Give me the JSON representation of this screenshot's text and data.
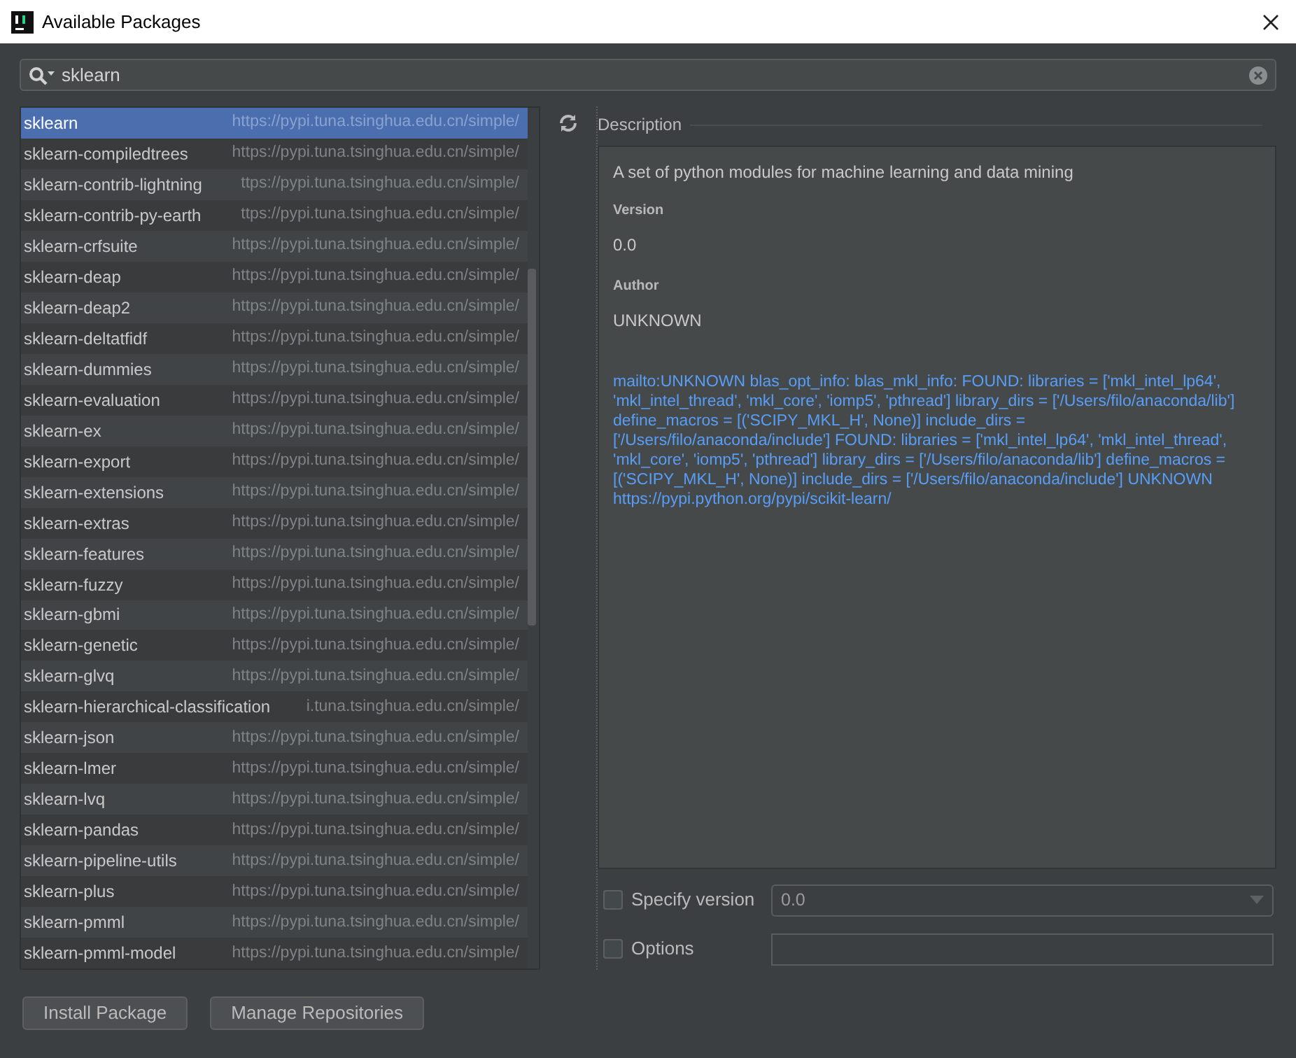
{
  "window": {
    "title": "Available Packages"
  },
  "search": {
    "value": "sklearn"
  },
  "packages": [
    {
      "name": "sklearn",
      "source": "https://pypi.tuna.tsinghua.edu.cn/simple/",
      "selected": true
    },
    {
      "name": "sklearn-compiledtrees",
      "source": "https://pypi.tuna.tsinghua.edu.cn/simple/",
      "selected": false
    },
    {
      "name": "sklearn-contrib-lightning",
      "source": "ttps://pypi.tuna.tsinghua.edu.cn/simple/",
      "selected": false
    },
    {
      "name": "sklearn-contrib-py-earth",
      "source": "ttps://pypi.tuna.tsinghua.edu.cn/simple/",
      "selected": false
    },
    {
      "name": "sklearn-crfsuite",
      "source": "https://pypi.tuna.tsinghua.edu.cn/simple/",
      "selected": false
    },
    {
      "name": "sklearn-deap",
      "source": "https://pypi.tuna.tsinghua.edu.cn/simple/",
      "selected": false
    },
    {
      "name": "sklearn-deap2",
      "source": "https://pypi.tuna.tsinghua.edu.cn/simple/",
      "selected": false
    },
    {
      "name": "sklearn-deltatfidf",
      "source": "https://pypi.tuna.tsinghua.edu.cn/simple/",
      "selected": false
    },
    {
      "name": "sklearn-dummies",
      "source": "https://pypi.tuna.tsinghua.edu.cn/simple/",
      "selected": false
    },
    {
      "name": "sklearn-evaluation",
      "source": "https://pypi.tuna.tsinghua.edu.cn/simple/",
      "selected": false
    },
    {
      "name": "sklearn-ex",
      "source": "https://pypi.tuna.tsinghua.edu.cn/simple/",
      "selected": false
    },
    {
      "name": "sklearn-export",
      "source": "https://pypi.tuna.tsinghua.edu.cn/simple/",
      "selected": false
    },
    {
      "name": "sklearn-extensions",
      "source": "https://pypi.tuna.tsinghua.edu.cn/simple/",
      "selected": false
    },
    {
      "name": "sklearn-extras",
      "source": "https://pypi.tuna.tsinghua.edu.cn/simple/",
      "selected": false
    },
    {
      "name": "sklearn-features",
      "source": "https://pypi.tuna.tsinghua.edu.cn/simple/",
      "selected": false
    },
    {
      "name": "sklearn-fuzzy",
      "source": "https://pypi.tuna.tsinghua.edu.cn/simple/",
      "selected": false
    },
    {
      "name": "sklearn-gbmi",
      "source": "https://pypi.tuna.tsinghua.edu.cn/simple/",
      "selected": false
    },
    {
      "name": "sklearn-genetic",
      "source": "https://pypi.tuna.tsinghua.edu.cn/simple/",
      "selected": false
    },
    {
      "name": "sklearn-glvq",
      "source": "https://pypi.tuna.tsinghua.edu.cn/simple/",
      "selected": false
    },
    {
      "name": "sklearn-hierarchical-classification",
      "source": "i.tuna.tsinghua.edu.cn/simple/",
      "selected": false
    },
    {
      "name": "sklearn-json",
      "source": "https://pypi.tuna.tsinghua.edu.cn/simple/",
      "selected": false
    },
    {
      "name": "sklearn-lmer",
      "source": "https://pypi.tuna.tsinghua.edu.cn/simple/",
      "selected": false
    },
    {
      "name": "sklearn-lvq",
      "source": "https://pypi.tuna.tsinghua.edu.cn/simple/",
      "selected": false
    },
    {
      "name": "sklearn-pandas",
      "source": "https://pypi.tuna.tsinghua.edu.cn/simple/",
      "selected": false
    },
    {
      "name": "sklearn-pipeline-utils",
      "source": "https://pypi.tuna.tsinghua.edu.cn/simple/",
      "selected": false
    },
    {
      "name": "sklearn-plus",
      "source": "https://pypi.tuna.tsinghua.edu.cn/simple/",
      "selected": false
    },
    {
      "name": "sklearn-pmml",
      "source": "https://pypi.tuna.tsinghua.edu.cn/simple/",
      "selected": false
    },
    {
      "name": "sklearn-pmml-model",
      "source": "https://pypi.tuna.tsinghua.edu.cn/simple/",
      "selected": false
    }
  ],
  "description": {
    "heading": "Description",
    "summary": "A set of python modules for machine learning and data mining",
    "version_label": "Version",
    "version": "0.0",
    "author_label": "Author",
    "author": "UNKNOWN",
    "details": "mailto:UNKNOWN blas_opt_info: blas_mkl_info: FOUND: libraries = ['mkl_intel_lp64', 'mkl_intel_thread', 'mkl_core', 'iomp5', 'pthread'] library_dirs = ['/Users/filo/anaconda/lib'] define_macros = [('SCIPY_MKL_H', None)] include_dirs = ['/Users/filo/anaconda/include'] FOUND: libraries = ['mkl_intel_lp64', 'mkl_intel_thread', 'mkl_core', 'iomp5', 'pthread'] library_dirs = ['/Users/filo/anaconda/lib'] define_macros = [('SCIPY_MKL_H', None)] include_dirs = ['/Users/filo/anaconda/include'] UNKNOWN",
    "link": "https://pypi.python.org/pypi/scikit-learn/"
  },
  "specify_version": {
    "label": "Specify version",
    "checked": false,
    "value": "0.0"
  },
  "options": {
    "label": "Options",
    "checked": false
  },
  "buttons": [
    "Install Package",
    "Manage Repositories"
  ]
}
